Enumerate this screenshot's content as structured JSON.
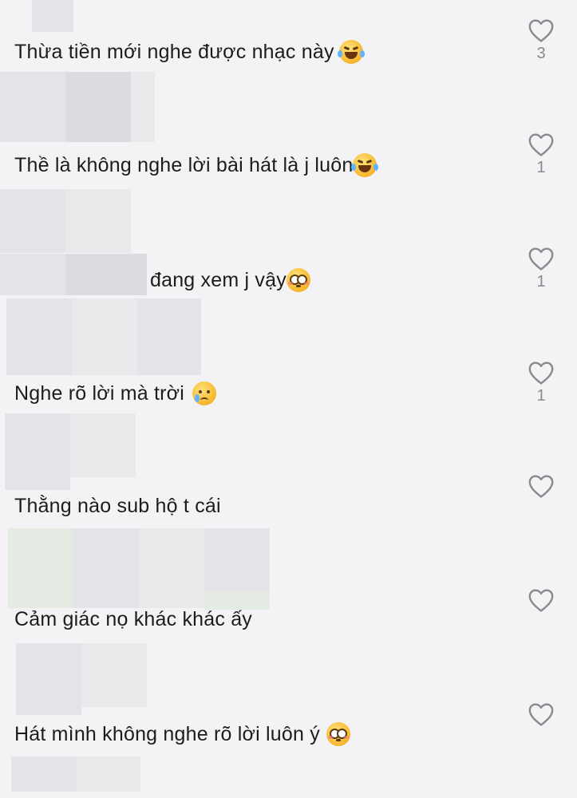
{
  "comments": [
    {
      "text": "Thừa tiền mới nghe được nhạc này",
      "emoji": "face-with-tears-of-joy",
      "likes": "3"
    },
    {
      "text": "Thề là không nghe lời bài hát là j luôn",
      "emoji": "face-with-tears-of-joy",
      "likes": "1"
    },
    {
      "text": "đang xem j vậy",
      "emoji": "flushed-face",
      "likes": "1"
    },
    {
      "text": "Nghe rõ lời mà trời",
      "emoji": "crying-face",
      "likes": "1"
    },
    {
      "text": "Thằng nào sub hộ t cái",
      "emoji": "",
      "likes": ""
    },
    {
      "text": "Cảm giác nọ khác khác ấy",
      "emoji": "",
      "likes": ""
    },
    {
      "text": "Hát mình không nghe rõ lời luôn ý",
      "emoji": "flushed-face",
      "likes": ""
    }
  ],
  "icons": {
    "like": "heart-outline-icon"
  },
  "colors": {
    "background": "#f3f3f5",
    "text": "#1c1c1e",
    "icon": "#8a8a8e"
  }
}
